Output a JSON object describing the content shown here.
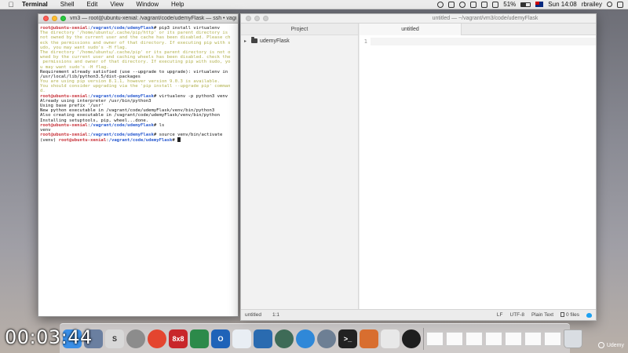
{
  "menubar": {
    "app_name": "Terminal",
    "menus": [
      "Shell",
      "Edit",
      "View",
      "Window",
      "Help"
    ],
    "battery": "51%",
    "clock": "Sun 14:08",
    "user": "rbrailey"
  },
  "terminal": {
    "title": "vm3 — root@ubuntu-xenial: /vagrant/code/udemyFlask — ssh • vagrant ssh",
    "prompt_user": "root@ubuntu-xenial",
    "prompt_path": "/vagrant/code/udemyFlask",
    "lines": [
      {
        "kind": "cmd",
        "text": "pip3 install virtualenv"
      },
      {
        "kind": "warn",
        "text": "The directory '/home/ubuntu/.cache/pip/http' or its parent directory is"
      },
      {
        "kind": "warn",
        "text": "not owned by the current user and the cache has been disabled. Please ch"
      },
      {
        "kind": "warn",
        "text": "eck the permissions and owner of that directory. If executing pip with s"
      },
      {
        "kind": "warn",
        "text": "udo, you may want sudo's -H flag."
      },
      {
        "kind": "warn",
        "text": "The directory '/home/ubuntu/.cache/pip' or its parent directory is not o"
      },
      {
        "kind": "warn",
        "text": "wned by the current user and caching wheels has been disabled. check the"
      },
      {
        "kind": "warn",
        "text": " permissions and owner of that directory. If executing pip with sudo, yo"
      },
      {
        "kind": "warn",
        "text": "u may want sudo's -H flag."
      },
      {
        "kind": "normal",
        "text": "Requirement already satisfied (use --upgrade to upgrade): virtualenv in"
      },
      {
        "kind": "normal",
        "text": "/usr/local/lib/python3.5/dist-packages"
      },
      {
        "kind": "warn",
        "text": "You are using pip version 8.1.1, however version 9.0.3 is available."
      },
      {
        "kind": "warn",
        "text": "You should consider upgrading via the 'pip install --upgrade pip' comman"
      },
      {
        "kind": "warn",
        "text": "d."
      },
      {
        "kind": "cmd",
        "text": "virtualenv -p python3 venv"
      },
      {
        "kind": "normal",
        "text": "Already using interpreter /usr/bin/python3"
      },
      {
        "kind": "normal",
        "text": "Using base prefix '/usr'"
      },
      {
        "kind": "normal",
        "text": "New python executable in /vagrant/code/udemyFlask/venv/bin/python3"
      },
      {
        "kind": "normal",
        "text": "Also creating executable in /vagrant/code/udemyFlask/venv/bin/python"
      },
      {
        "kind": "normal",
        "text": "Installing setuptools, pip, wheel...done."
      },
      {
        "kind": "cmd",
        "text": "ls"
      },
      {
        "kind": "normal",
        "text": "venv"
      },
      {
        "kind": "cmd",
        "text": "source venv/bin/activate"
      },
      {
        "kind": "venv",
        "prefix": "(venv) ",
        "text": ""
      }
    ]
  },
  "atom": {
    "title": "untitled — ~/vagrant/vm3/code/udemyFlask",
    "tree_header": "Project",
    "folder": "udemyFlask",
    "tab": "untitled",
    "line_number": "1",
    "status": {
      "file": "untitled",
      "position": "1:1",
      "line_ending": "LF",
      "encoding": "UTF-8",
      "grammar": "Plain Text",
      "files": "0 files"
    }
  },
  "dock": {
    "apps": [
      {
        "icon": "finder-icon",
        "color": "#3a8ee6",
        "label": ""
      },
      {
        "icon": "launchpad-icon",
        "color": "#6a7fa0",
        "label": ""
      },
      {
        "icon": "scrivener-icon",
        "color": "#d8d8d8",
        "label": "S"
      },
      {
        "icon": "system-preferences-icon",
        "color": "#8c8c8c",
        "label": ""
      },
      {
        "icon": "chrome-icon",
        "color": "#e4452f",
        "label": ""
      },
      {
        "icon": "8x8-icon",
        "color": "#c8262b",
        "label": "8x8"
      },
      {
        "icon": "screen-sharing-icon",
        "color": "#2c8a4a",
        "label": ""
      },
      {
        "icon": "outlook-icon",
        "color": "#1f63b8",
        "label": "O"
      },
      {
        "icon": "mail-icon",
        "color": "#e9eef4",
        "label": ""
      },
      {
        "icon": "virtualbox-icon",
        "color": "#2a6bb0",
        "label": ""
      },
      {
        "icon": "atom-icon",
        "color": "#3e6b57",
        "label": ""
      },
      {
        "icon": "safari-icon",
        "color": "#2f88d8",
        "label": ""
      },
      {
        "icon": "globe-icon",
        "color": "#6d7f94",
        "label": ""
      },
      {
        "icon": "terminal-icon",
        "color": "#222222",
        "label": ">_"
      },
      {
        "icon": "pen-icon",
        "color": "#d86e2f",
        "label": ""
      },
      {
        "icon": "preview-icon",
        "color": "#e8e8e8",
        "label": ""
      },
      {
        "icon": "obs-icon",
        "color": "#1e1e1e",
        "label": ""
      }
    ],
    "trash_icon": "trash-icon"
  },
  "overlay": {
    "timecode": "00:03:44",
    "brand": "Udemy"
  }
}
